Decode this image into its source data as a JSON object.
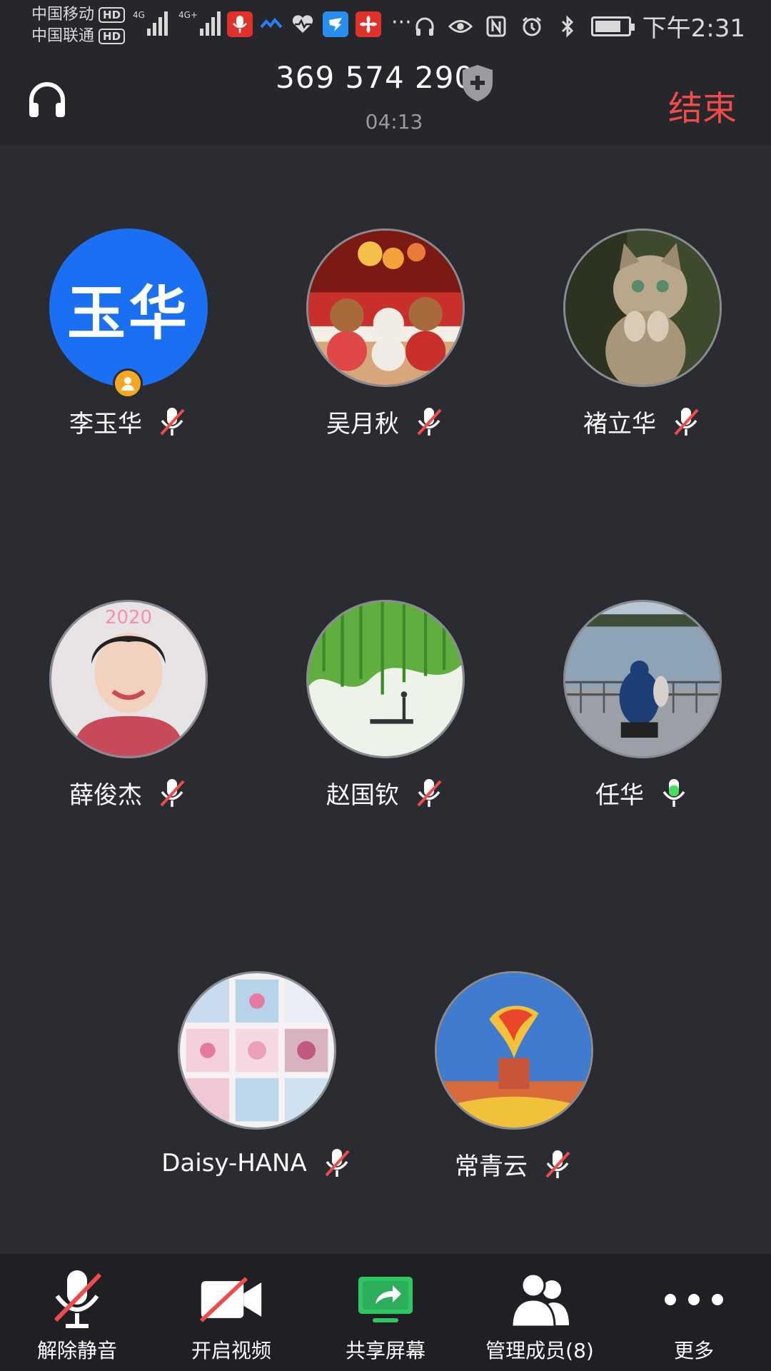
{
  "status_bar": {
    "carrier_1": "中国移动",
    "carrier_2": "中国联通",
    "hd": "HD",
    "network_1": "4G",
    "network_2": "4G+",
    "overflow": "···",
    "time": "下午2:31"
  },
  "header": {
    "meeting_id": "369 574 290",
    "duration": "04:13",
    "end_label": "结束"
  },
  "participants": [
    {
      "name": "李玉华",
      "avatar_text": "玉华",
      "is_host": true,
      "mic": "muted"
    },
    {
      "name": "吴月秋",
      "avatar": "teddy-bears-photo",
      "mic": "muted"
    },
    {
      "name": "褚立华",
      "avatar": "kitten-photo",
      "mic": "muted"
    },
    {
      "name": "薛俊杰",
      "avatar": "woman-selfie-photo",
      "mic": "muted"
    },
    {
      "name": "赵国钦",
      "avatar": "willow-lake-photo",
      "mic": "muted"
    },
    {
      "name": "任华",
      "avatar": "lakeside-person-photo",
      "mic": "active"
    },
    {
      "name": "Daisy-HANA",
      "avatar": "flower-collage-photo",
      "mic": "muted"
    },
    {
      "name": "常青云",
      "avatar": "torch-monument-photo",
      "mic": "muted"
    }
  ],
  "toolbar": {
    "unmute": "解除静音",
    "start_video": "开启视频",
    "share_screen": "共享屏幕",
    "manage_members": "管理成员(8)",
    "more": "更多"
  },
  "colors": {
    "background": "#2b2c31",
    "header": "#26272b",
    "toolbar": "#1f2024",
    "end_red": "#f04a4a",
    "avatar_blue": "#1a6ff2",
    "share_green": "#2fc764",
    "mic_active_green": "#4cd964",
    "host_badge": "#f5a623"
  }
}
